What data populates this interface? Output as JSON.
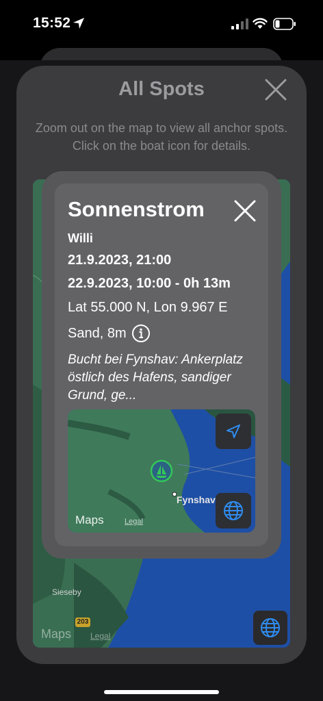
{
  "status_bar": {
    "time": "15:52"
  },
  "sheet": {
    "title": "All Spots",
    "description": "Zoom out on the map to view all anchor spots. Click on the boat icon for details.",
    "map": {
      "attribution": "Maps",
      "legal": "Legal",
      "place_label": "Sieseby",
      "road_number": "203"
    }
  },
  "spot": {
    "name": "Sonnenstrom",
    "owner": "Willi",
    "start": "21.9.2023, 21:00",
    "end": "22.9.2023, 10:00 - 0h 13m",
    "coordinates": "Lat 55.000 N, Lon 9.967 E",
    "ground": "Sand, 8m",
    "description": "Bucht bei Fynshav: Ankerplatz östlich des Hafens, sandiger Grund, ge...",
    "map": {
      "attribution": "Maps",
      "legal": "Legal",
      "place_label": "Fynshav"
    }
  },
  "colors": {
    "accent_blue": "#2f8cf0",
    "marker_green": "#34c759",
    "water": "#1e4fa6",
    "land": "#3f7a5a"
  },
  "icons": {
    "close": "close-icon",
    "info": "info-icon",
    "navigate": "location-arrow-icon",
    "globe": "globe-icon",
    "boat": "sailboat-icon"
  }
}
